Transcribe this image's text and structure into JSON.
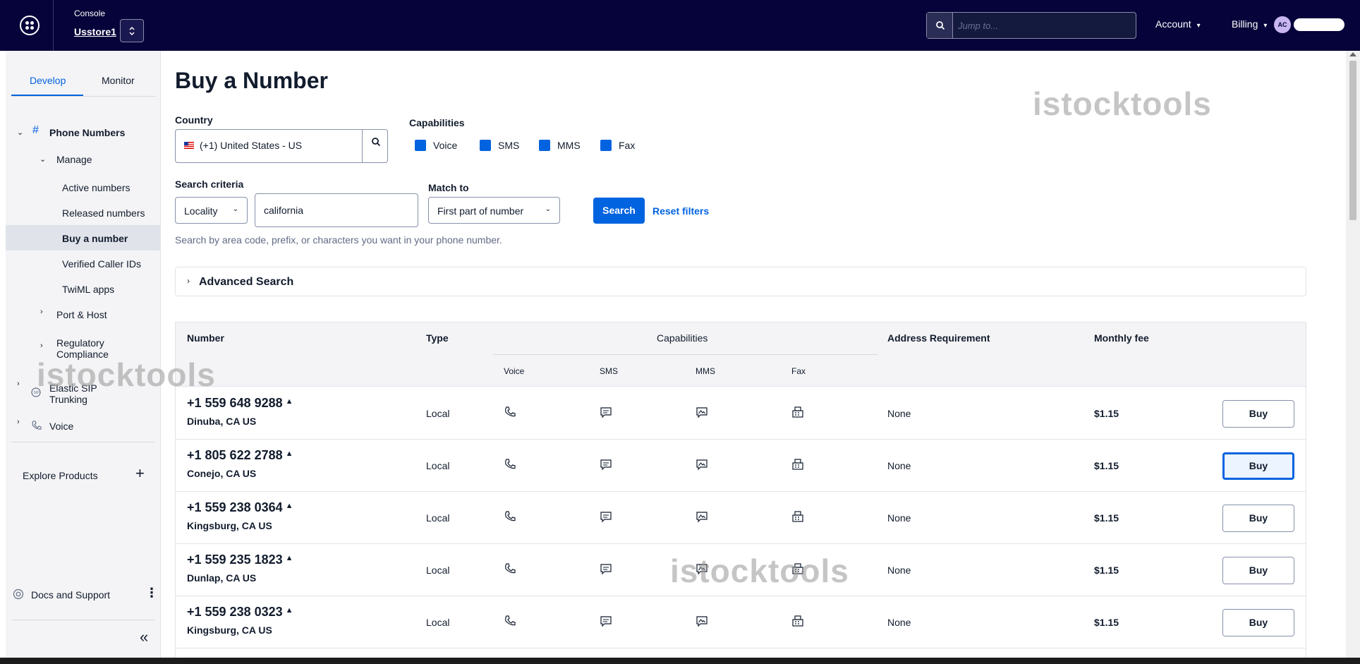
{
  "topbar": {
    "console_label": "Console",
    "account_name": "Usstore1",
    "search_placeholder": "Jump to...",
    "account_menu": "Account",
    "billing_menu": "Billing",
    "avatar_initials": "AC"
  },
  "sidebar": {
    "tabs": [
      "Develop",
      "Monitor"
    ],
    "active_tab": "Develop",
    "phone_numbers": "Phone Numbers",
    "manage": "Manage",
    "manage_items": [
      "Active numbers",
      "Released numbers",
      "Buy a number",
      "Verified Caller IDs",
      "TwiML apps"
    ],
    "selected_item": "Buy a number",
    "port_host": "Port & Host",
    "regulatory_line1": "Regulatory",
    "regulatory_line2": "Compliance",
    "elastic_line1": "Elastic SIP",
    "elastic_line2": "Trunking",
    "voice": "Voice",
    "explore_products": "Explore Products",
    "docs_support": "Docs and Support"
  },
  "main": {
    "title": "Buy a Number",
    "country_label": "Country",
    "country_value": "(+1) United States - US",
    "capabilities_label": "Capabilities",
    "capabilities": [
      "Voice",
      "SMS",
      "MMS",
      "Fax"
    ],
    "search_criteria_label": "Search criteria",
    "criteria_select": "Locality",
    "criteria_value": "california",
    "match_to_label": "Match to",
    "match_to_select": "First part of number",
    "search_button": "Search",
    "reset_link": "Reset filters",
    "help_text": "Search by area code, prefix, or characters you want in your phone number.",
    "advanced_search": "Advanced Search"
  },
  "table": {
    "headers": {
      "number": "Number",
      "type": "Type",
      "capabilities": "Capabilities",
      "address": "Address Requirement",
      "fee": "Monthly fee"
    },
    "cap_headers": [
      "Voice",
      "SMS",
      "MMS",
      "Fax"
    ],
    "buy_label": "Buy",
    "rows": [
      {
        "number": "+1 559 648 9288",
        "location": "Dinuba, CA US",
        "type": "Local",
        "address": "None",
        "fee": "$1.15"
      },
      {
        "number": "+1 805 622 2788",
        "location": "Conejo, CA US",
        "type": "Local",
        "address": "None",
        "fee": "$1.15"
      },
      {
        "number": "+1 559 238 0364",
        "location": "Kingsburg, CA US",
        "type": "Local",
        "address": "None",
        "fee": "$1.15"
      },
      {
        "number": "+1 559 235 1823",
        "location": "Dunlap, CA US",
        "type": "Local",
        "address": "None",
        "fee": "$1.15"
      },
      {
        "number": "+1 559 238 0323",
        "location": "Kingsburg, CA US",
        "type": "Local",
        "address": "None",
        "fee": "$1.15"
      }
    ]
  },
  "watermark": "istocktools",
  "colors": {
    "topbar": "#06033a",
    "accent": "#0263e0",
    "sidebar": "#f4f4f6"
  }
}
